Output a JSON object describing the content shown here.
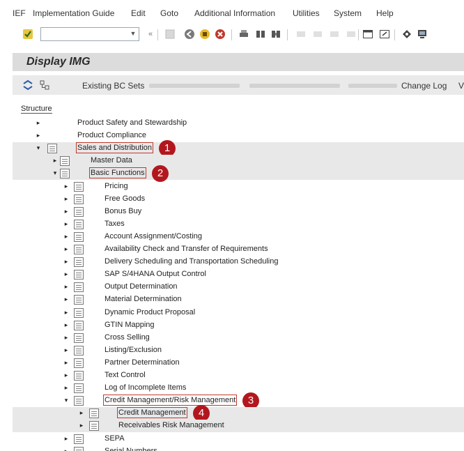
{
  "menubar": {
    "items": [
      "IEF",
      "Implementation Guide",
      "Edit",
      "Goto",
      "Additional Information",
      "Utilities",
      "System",
      "Help"
    ]
  },
  "toolbar": {
    "command_value": "",
    "icons": [
      "check-icon",
      "command-dropdown-icon",
      "collapse-icon",
      "save-icon",
      "back-icon",
      "exit-icon",
      "cancel-icon",
      "print-icon",
      "find-icon",
      "find-next-icon",
      "layout-icon",
      "new-session-icon",
      "customize-icon",
      "monitor-icon"
    ]
  },
  "title": "Display IMG",
  "app_toolbar": {
    "existing_bc_sets": "Existing BC Sets",
    "change_log": "Change Log",
    "more": "V"
  },
  "tree": {
    "header": "Structure",
    "nodes": [
      {
        "label": "Product Safety and Stewardship",
        "level": 0,
        "expanded": false
      },
      {
        "label": "Product Compliance",
        "level": 0,
        "expanded": false
      },
      {
        "label": "Sales and Distribution",
        "level": 0,
        "expanded": true,
        "marker": "1"
      },
      {
        "label": "Master Data",
        "level": 1,
        "expanded": false
      },
      {
        "label": "Basic Functions",
        "level": 1,
        "expanded": true,
        "marker": "2"
      },
      {
        "label": "Pricing",
        "level": 2,
        "expanded": false
      },
      {
        "label": "Free Goods",
        "level": 2,
        "expanded": false
      },
      {
        "label": "Bonus Buy",
        "level": 2,
        "expanded": false
      },
      {
        "label": "Taxes",
        "level": 2,
        "expanded": false
      },
      {
        "label": "Account Assignment/Costing",
        "level": 2,
        "expanded": false
      },
      {
        "label": "Availability Check and Transfer of Requirements",
        "level": 2,
        "expanded": false
      },
      {
        "label": "Delivery Scheduling and Transportation Scheduling",
        "level": 2,
        "expanded": false
      },
      {
        "label": "SAP S/4HANA Output Control",
        "level": 2,
        "expanded": false
      },
      {
        "label": "Output Determination",
        "level": 2,
        "expanded": false
      },
      {
        "label": "Material Determination",
        "level": 2,
        "expanded": false
      },
      {
        "label": "Dynamic Product Proposal",
        "level": 2,
        "expanded": false
      },
      {
        "label": "GTIN Mapping",
        "level": 2,
        "expanded": false
      },
      {
        "label": "Cross Selling",
        "level": 2,
        "expanded": false
      },
      {
        "label": "Listing/Exclusion",
        "level": 2,
        "expanded": false
      },
      {
        "label": "Partner Determination",
        "level": 2,
        "expanded": false
      },
      {
        "label": "Text Control",
        "level": 2,
        "expanded": false
      },
      {
        "label": "Log of Incomplete Items",
        "level": 2,
        "expanded": false
      },
      {
        "label": "Credit Management/Risk Management",
        "level": 2,
        "expanded": true,
        "marker": "3"
      },
      {
        "label": "Credit Management",
        "level": 3,
        "expanded": false,
        "marker": "4"
      },
      {
        "label": "Receivables Risk Management",
        "level": 3,
        "expanded": false
      },
      {
        "label": "SEPA",
        "level": 2,
        "expanded": false
      },
      {
        "label": "Serial Numbers",
        "level": 2,
        "expanded": false
      }
    ]
  },
  "colors": {
    "marker": "#b3171e",
    "highlight_box": "#c0392b",
    "title_bg": "#dcdcdc"
  }
}
